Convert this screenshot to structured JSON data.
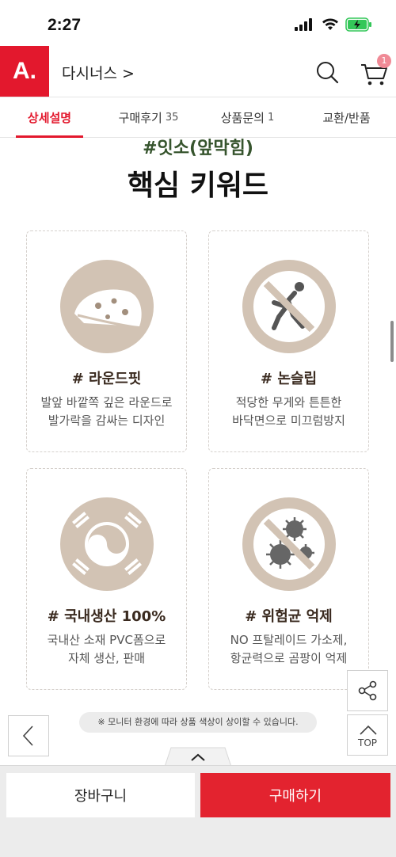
{
  "status_bar": {
    "time": "2:27"
  },
  "header": {
    "logo": "A.",
    "brand": "다시너스 >",
    "cart_badge": "1"
  },
  "tabs": [
    {
      "label": "상세설명",
      "count": ""
    },
    {
      "label": "구매후기",
      "count": "35"
    },
    {
      "label": "상품문의",
      "count": "1"
    },
    {
      "label": "교환/반품",
      "count": ""
    }
  ],
  "content": {
    "hashtag": "#잇소(앞막힘)",
    "title": "핵심 키워드",
    "cards": [
      {
        "title": "# 라운드핏",
        "desc_line1": "발앞 바깥쪽 깊은 라운드로",
        "desc_line2": "발가락을 감싸는 디자인",
        "icon": "round-fit-icon"
      },
      {
        "title": "# 논슬립",
        "desc_line1": "적당한 무게와 튼튼한",
        "desc_line2": "바닥면으로 미끄럼방지",
        "icon": "non-slip-icon"
      },
      {
        "title": "# 국내생산 100%",
        "desc_line1": "국내산 소재 PVC폼으로",
        "desc_line2": "자체 생산, 판매",
        "icon": "korea-flag-icon"
      },
      {
        "title": "# 위험균 억제",
        "desc_line1": "NO 프탈레이드 가소제,",
        "desc_line2": "항균력으로 곰팡이 억제",
        "icon": "anti-bacteria-icon"
      }
    ]
  },
  "floating": {
    "top_label": "TOP",
    "notice": "※ 모니터 환경에 따라 상품 색상이 상이할 수 있습니다."
  },
  "bottom_bar": {
    "cart_label": "장바구니",
    "buy_label": "구매하기"
  },
  "colors": {
    "brand": "#e3182d",
    "illus_bg": "#d2c3b4",
    "illus_fg": "#fff",
    "buy_button": "#e3232f"
  }
}
